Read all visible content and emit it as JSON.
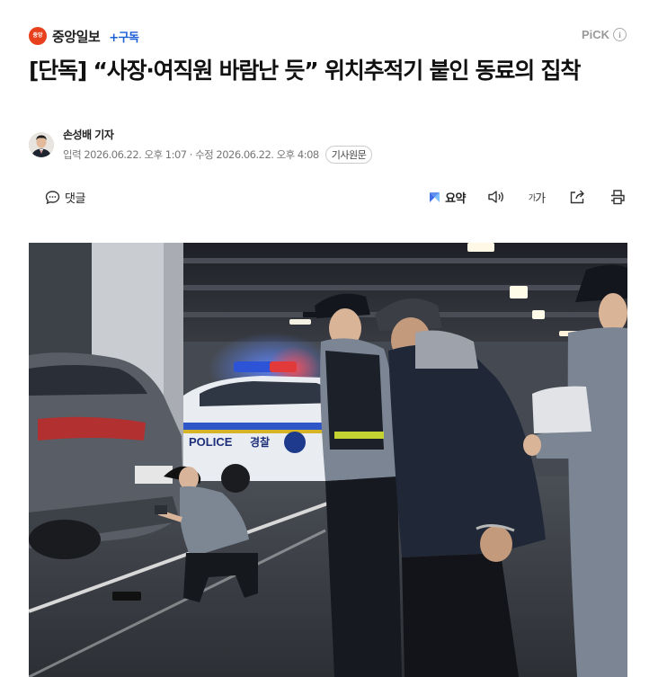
{
  "press": {
    "logo_text": "중앙",
    "name": "중앙일보",
    "subscribe_label": "+구독",
    "pick_label": "PiCK",
    "info_icon": "info-circle-icon"
  },
  "article": {
    "headline": "[단독] “사장·여직원 바람난 듯” 위치추적기 붙인 동료의 집착",
    "reporter": "손성배 기자",
    "input_label": "입력",
    "input_date": "2026.06.22. 오후 1:07",
    "separator": "·",
    "modified_label": "수정",
    "modified_date": "2026.06.22. 오후 4:08",
    "original_button": "기사원문"
  },
  "toolbar": {
    "comment_label": "댓글",
    "summary_label": "요약",
    "fontsize_small": "가",
    "fontsize_large": "가",
    "icons": [
      "comment-icon",
      "summary-icon",
      "audio-icon",
      "fontsize-icon",
      "share-icon",
      "print-icon"
    ]
  },
  "photo": {
    "police_text": "POLICE",
    "police_text_ko": "경찰",
    "colors": {
      "ceiling": "#2a2d34",
      "wall": "#3a3f47",
      "floor": "#3b3f45",
      "police_blue": "#2b5bd8",
      "police_red": "#e23a3a"
    }
  }
}
